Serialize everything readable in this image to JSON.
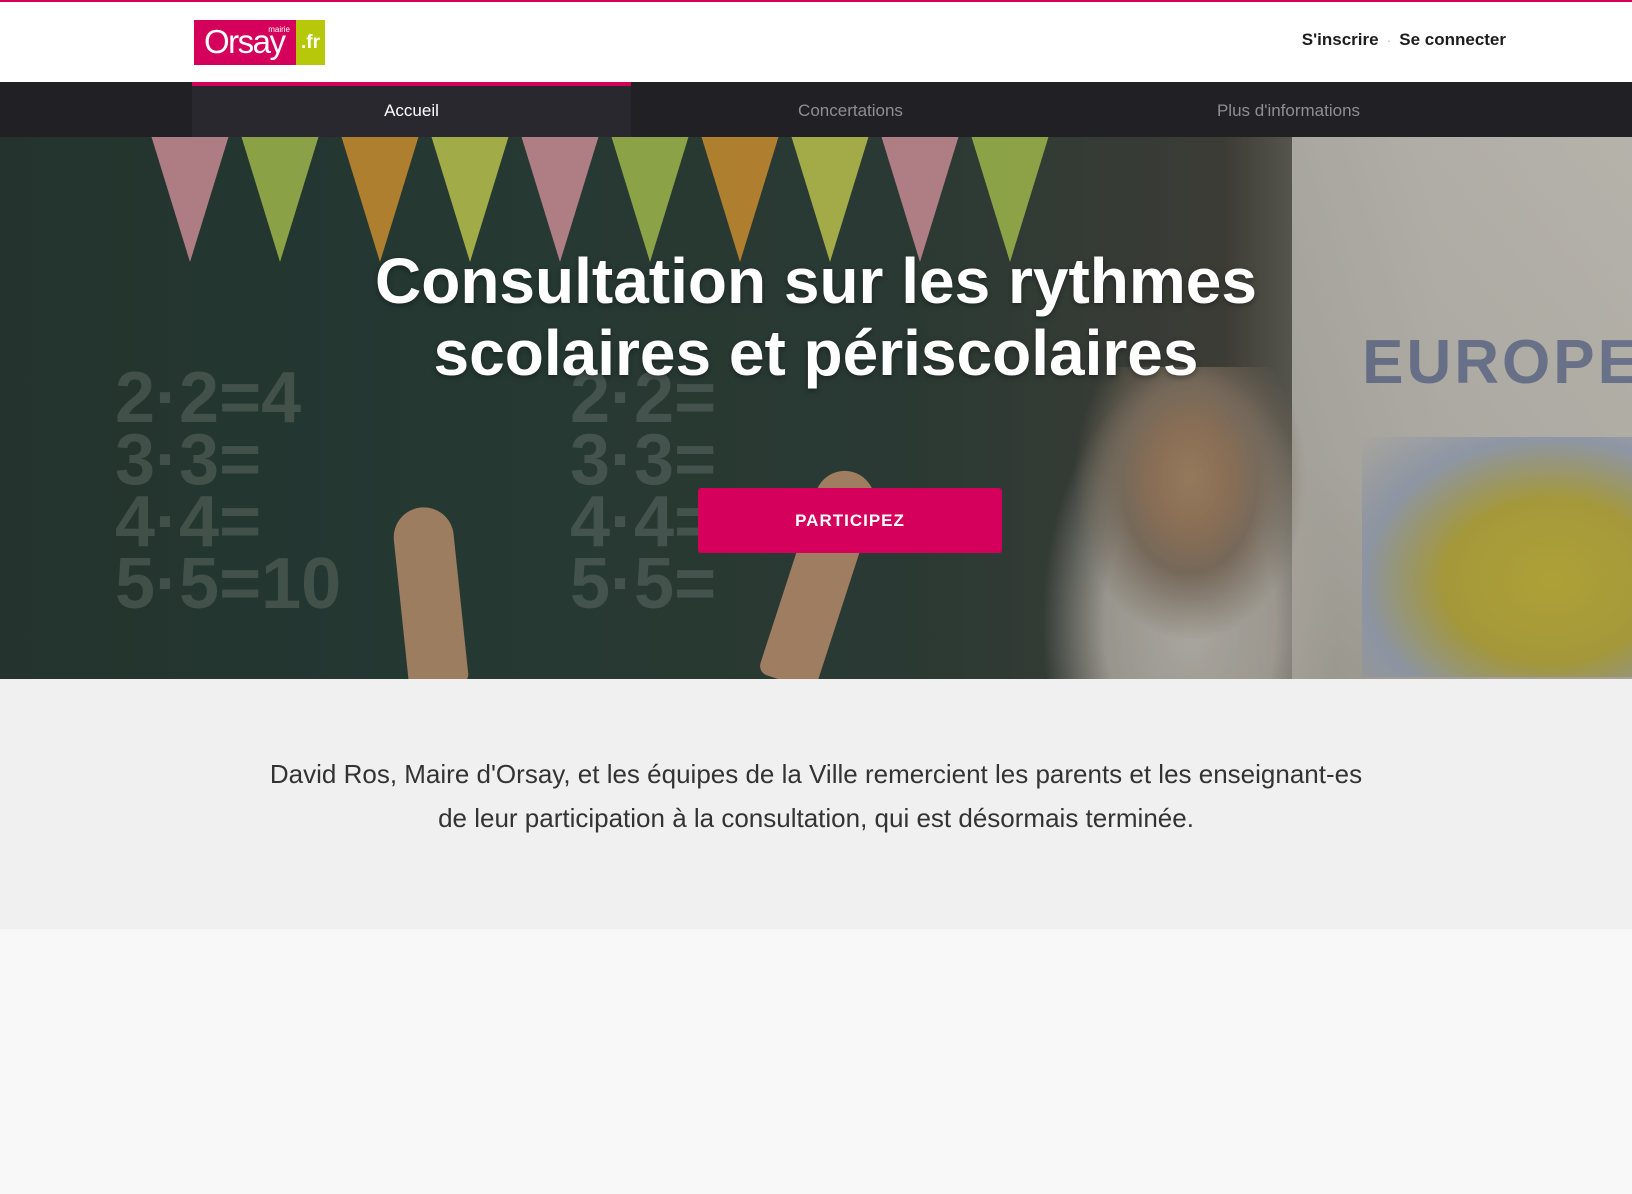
{
  "header": {
    "logo": {
      "brand": "Orsay",
      "tagline": "mairie",
      "tld": ".fr",
      "colors": {
        "primary": "#d5005b",
        "secondary": "#b7c80b"
      }
    },
    "signup_label": "S'inscrire",
    "login_label": "Se connecter",
    "separator": "·"
  },
  "nav": {
    "items": [
      {
        "label": "Accueil",
        "active": true
      },
      {
        "label": "Concertations",
        "active": false
      },
      {
        "label": "Plus d'informations",
        "active": false
      }
    ]
  },
  "hero": {
    "title_line1": "Consultation sur les rythmes",
    "title_line2": "scolaires et périscolaires",
    "cta_label": "PARTICIPEZ"
  },
  "intro": {
    "text_line1": "David Ros, Maire d'Orsay, et les équipes de la Ville remercient les parents et les enseignant-es",
    "text_line2": "de leur participation à la consultation, qui est désormais terminée."
  },
  "theme": {
    "accent": "#d5005b",
    "nav_background": "#202025",
    "intro_background": "#f0f0f0"
  }
}
